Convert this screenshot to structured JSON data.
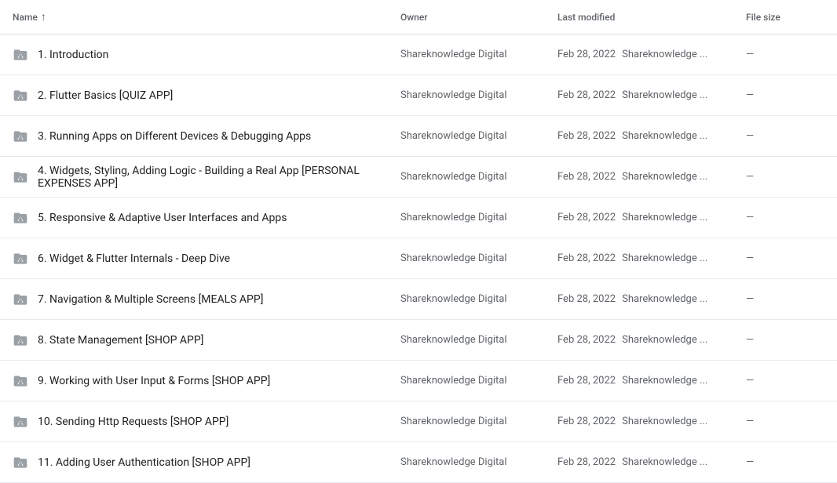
{
  "header": {
    "col_name": "Name",
    "col_owner": "Owner",
    "col_modified": "Last modified",
    "col_size": "File size",
    "sort_arrow": "↑"
  },
  "rows": [
    {
      "id": 1,
      "name": "1. Introduction",
      "owner": "Shareknowledge Digital",
      "modified_date": "Feb 28, 2022",
      "modified_user": "Shareknowledge ...",
      "size": "—"
    },
    {
      "id": 2,
      "name": "2. Flutter Basics [QUIZ APP]",
      "owner": "Shareknowledge Digital",
      "modified_date": "Feb 28, 2022",
      "modified_user": "Shareknowledge ...",
      "size": "—"
    },
    {
      "id": 3,
      "name": "3. Running Apps on Different Devices & Debugging Apps",
      "owner": "Shareknowledge Digital",
      "modified_date": "Feb 28, 2022",
      "modified_user": "Shareknowledge ...",
      "size": "—"
    },
    {
      "id": 4,
      "name": "4. Widgets, Styling, Adding Logic - Building a Real App [PERSONAL EXPENSES APP]",
      "owner": "Shareknowledge Digital",
      "modified_date": "Feb 28, 2022",
      "modified_user": "Shareknowledge ...",
      "size": "—"
    },
    {
      "id": 5,
      "name": "5. Responsive & Adaptive User Interfaces and Apps",
      "owner": "Shareknowledge Digital",
      "modified_date": "Feb 28, 2022",
      "modified_user": "Shareknowledge ...",
      "size": "—"
    },
    {
      "id": 6,
      "name": "6. Widget & Flutter Internals - Deep Dive",
      "owner": "Shareknowledge Digital",
      "modified_date": "Feb 28, 2022",
      "modified_user": "Shareknowledge ...",
      "size": "—"
    },
    {
      "id": 7,
      "name": "7. Navigation & Multiple Screens [MEALS APP]",
      "owner": "Shareknowledge Digital",
      "modified_date": "Feb 28, 2022",
      "modified_user": "Shareknowledge ...",
      "size": "—"
    },
    {
      "id": 8,
      "name": "8. State Management [SHOP APP]",
      "owner": "Shareknowledge Digital",
      "modified_date": "Feb 28, 2022",
      "modified_user": "Shareknowledge ...",
      "size": "—"
    },
    {
      "id": 9,
      "name": "9. Working with User Input & Forms [SHOP APP]",
      "owner": "Shareknowledge Digital",
      "modified_date": "Feb 28, 2022",
      "modified_user": "Shareknowledge ...",
      "size": "—"
    },
    {
      "id": 10,
      "name": "10. Sending Http Requests [SHOP APP]",
      "owner": "Shareknowledge Digital",
      "modified_date": "Feb 28, 2022",
      "modified_user": "Shareknowledge ...",
      "size": "—"
    },
    {
      "id": 11,
      "name": "11. Adding User Authentication [SHOP APP]",
      "owner": "Shareknowledge Digital",
      "modified_date": "Feb 28, 2022",
      "modified_user": "Shareknowledge ...",
      "size": "—"
    }
  ]
}
